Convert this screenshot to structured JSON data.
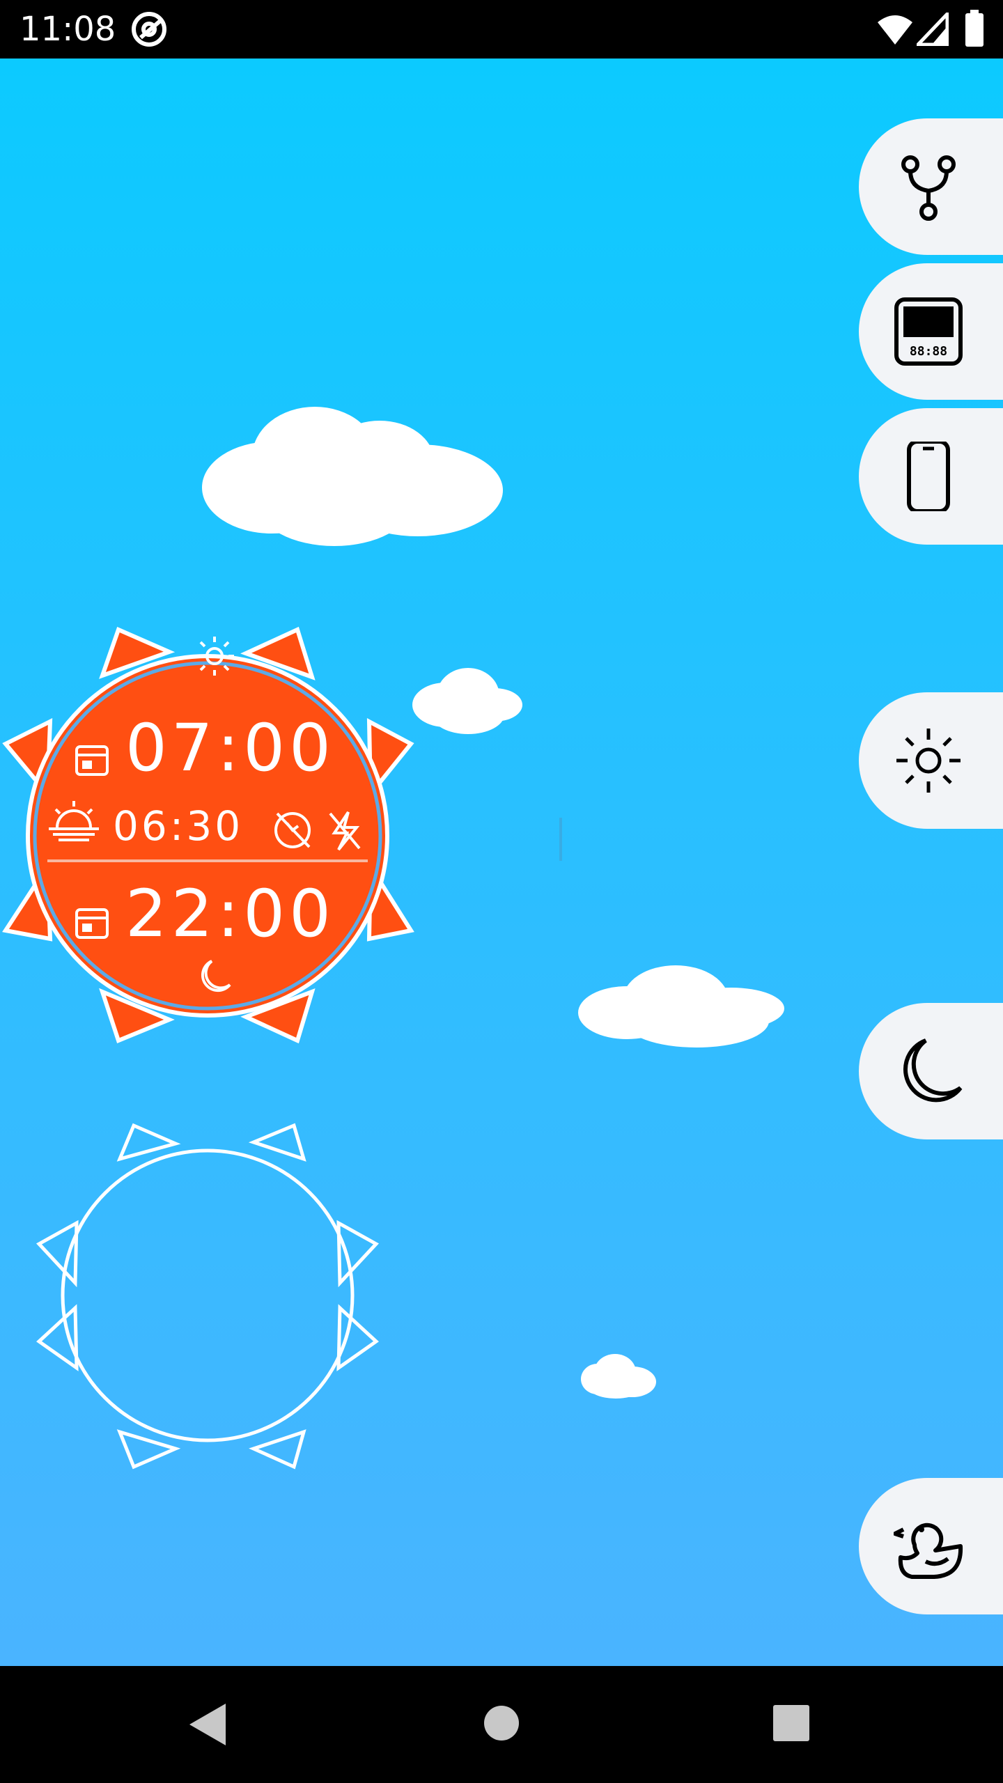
{
  "status_bar": {
    "time": "11:08",
    "icons": [
      "at-sign-icon",
      "wifi-icon",
      "signal-icon",
      "battery-icon"
    ]
  },
  "sun_clock": {
    "wake_time": "07:00",
    "sunrise_time": "06:30",
    "sleep_time": "22:00",
    "color": "#ff4f12"
  },
  "side_buttons": [
    {
      "name": "fork-icon"
    },
    {
      "name": "led-clock-icon"
    },
    {
      "name": "phone-icon"
    },
    {
      "name": "sun-icon"
    },
    {
      "name": "moon-icon"
    },
    {
      "name": "duck-icon"
    }
  ],
  "colors": {
    "sky_top": "#0ccaff",
    "sky_bottom": "#4ab4ff",
    "sun": "#ff4f12",
    "pill": "#f2f4f7"
  },
  "nav_bar": {
    "icons": [
      "back-icon",
      "home-icon",
      "recents-icon"
    ]
  }
}
